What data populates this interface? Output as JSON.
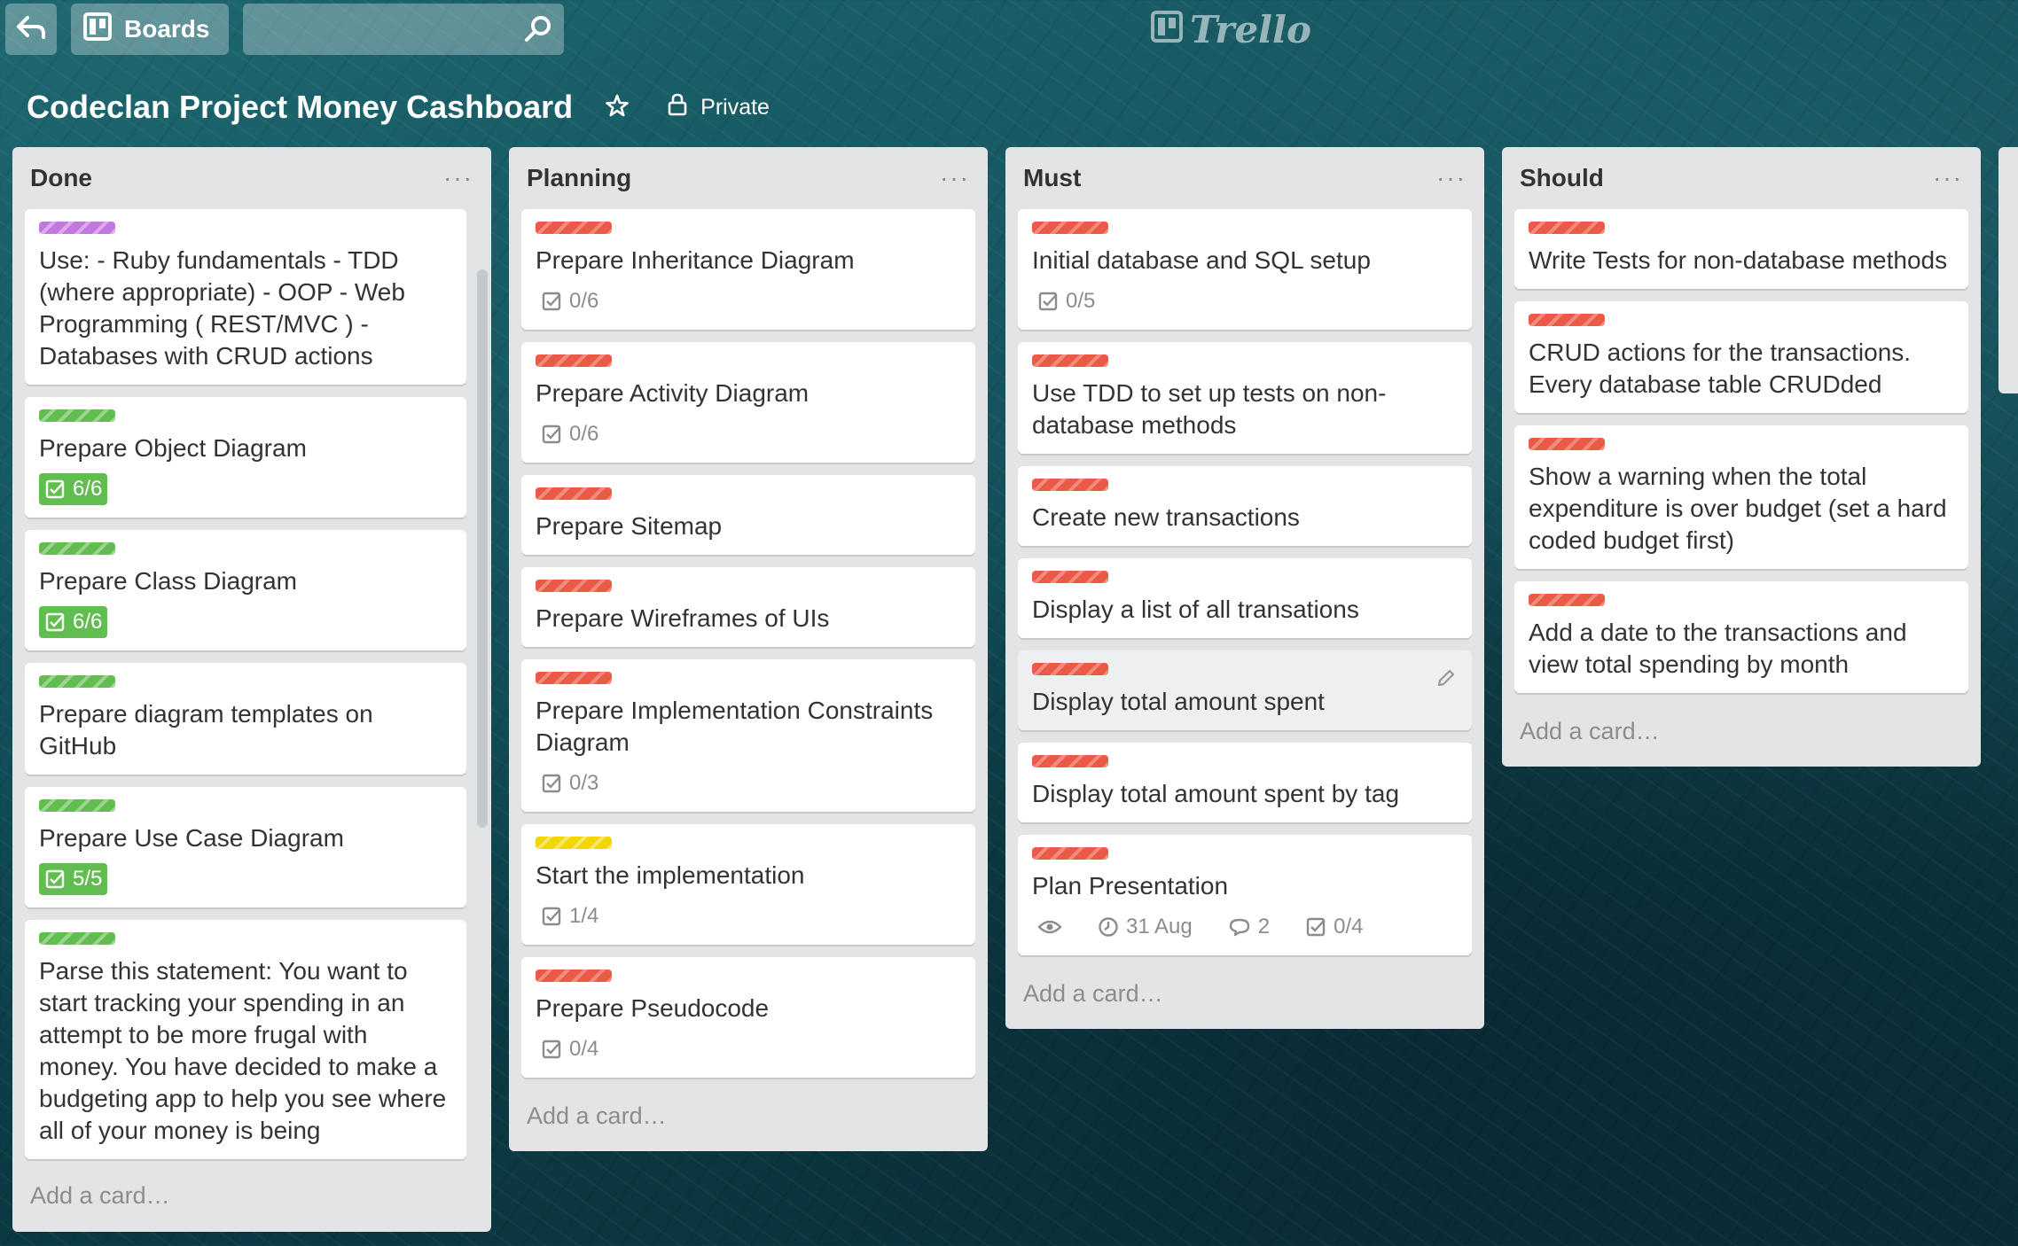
{
  "header": {
    "boards_label": "Boards",
    "search_placeholder": "",
    "logo_text": "Trello"
  },
  "board": {
    "title": "Codeclan Project Money Cashboard",
    "visibility": "Private"
  },
  "colors": {
    "label_red": "#eb5a46",
    "label_green": "#61bd4f",
    "label_purple": "#c377e0",
    "label_yellow": "#f2d600",
    "checklist_complete": "#61bd4f",
    "list_bg": "#e2e4e6"
  },
  "lists": [
    {
      "title": "Done",
      "add_card": "Add a card…",
      "cards": [
        {
          "label": "purple",
          "title": "Use: - Ruby fundamentals - TDD (where appropriate) - OOP - Web Programming ( REST/MVC ) - Databases with CRUD actions"
        },
        {
          "label": "green",
          "title": "Prepare Object Diagram",
          "checklist": "6/6",
          "complete": true
        },
        {
          "label": "green",
          "title": "Prepare Class Diagram",
          "checklist": "6/6",
          "complete": true
        },
        {
          "label": "green",
          "title": "Prepare diagram templates on GitHub"
        },
        {
          "label": "green",
          "title": "Prepare Use Case Diagram",
          "checklist": "5/5",
          "complete": true
        },
        {
          "label": "green",
          "title": "Parse this statement: You want to start tracking your spending in an attempt to be more frugal with money. You have decided to make a budgeting app to help you see where all of your money is being"
        }
      ]
    },
    {
      "title": "Planning",
      "add_card": "Add a card…",
      "cards": [
        {
          "label": "red",
          "title": "Prepare Inheritance Diagram",
          "checklist": "0/6"
        },
        {
          "label": "red",
          "title": "Prepare Activity Diagram",
          "checklist": "0/6"
        },
        {
          "label": "red",
          "title": "Prepare Sitemap"
        },
        {
          "label": "red",
          "title": "Prepare Wireframes of UIs"
        },
        {
          "label": "red",
          "title": "Prepare Implementation Constraints Diagram",
          "checklist": "0/3"
        },
        {
          "label": "yellow",
          "title": "Start the implementation",
          "checklist": "1/4"
        },
        {
          "label": "red",
          "title": "Prepare Pseudocode",
          "checklist": "0/4"
        }
      ]
    },
    {
      "title": "Must",
      "add_card": "Add a card…",
      "cards": [
        {
          "label": "red",
          "title": "Initial database and SQL setup",
          "checklist": "0/5"
        },
        {
          "label": "red",
          "title": "Use TDD to set up tests on non-database methods"
        },
        {
          "label": "red",
          "title": "Create new transactions"
        },
        {
          "label": "red",
          "title": "Display a list of all transations"
        },
        {
          "label": "red",
          "title": "Display total amount spent"
        },
        {
          "label": "red",
          "title": "Display total amount spent by tag"
        },
        {
          "label": "red",
          "title": "Plan Presentation",
          "due": "31 Aug",
          "comments": "2",
          "checklist": "0/4",
          "watching": true
        }
      ]
    },
    {
      "title": "Should",
      "add_card": "Add a card…",
      "cards": [
        {
          "label": "red",
          "title": "Write Tests for non-database methods"
        },
        {
          "label": "red",
          "title": "CRUD actions for the transactions. Every database table CRUDded"
        },
        {
          "label": "red",
          "title": "Show a warning when the total expenditure is over budget (set a hard coded budget first)"
        },
        {
          "label": "red",
          "title": "Add a date to the transactions and view total spending by month"
        }
      ]
    }
  ]
}
